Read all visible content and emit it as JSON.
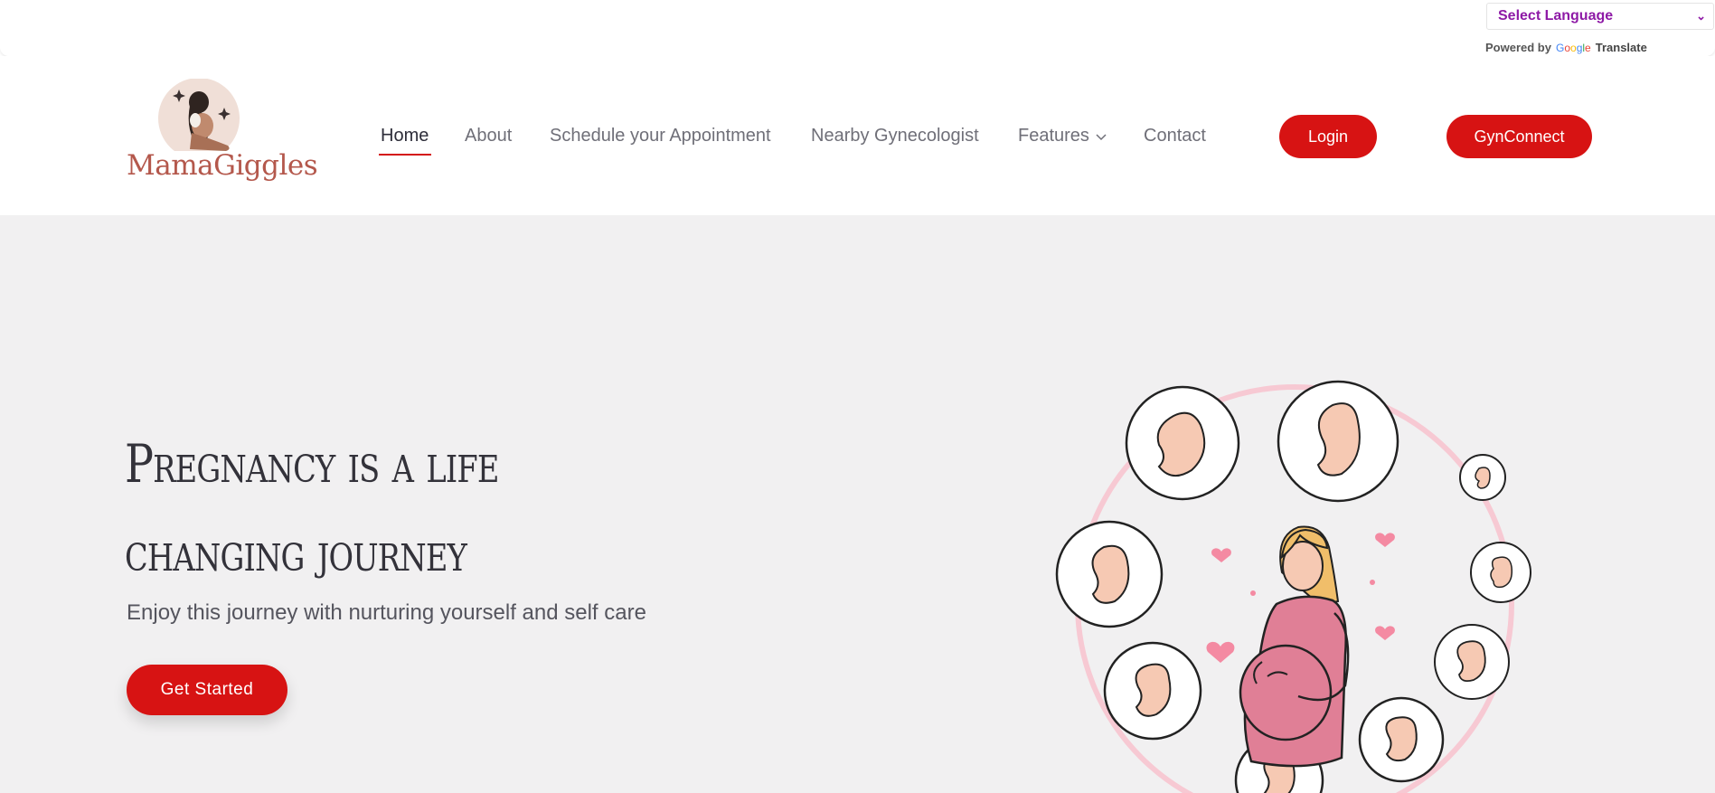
{
  "translate": {
    "select_label": "Select Language",
    "powered_by": "Powered by",
    "google": "Google",
    "translate": "Translate"
  },
  "brand": {
    "name": "MamaGiggles"
  },
  "nav": {
    "items": [
      {
        "label": "Home"
      },
      {
        "label": "About"
      },
      {
        "label": "Schedule your Appointment"
      },
      {
        "label": "Nearby Gynecologist"
      },
      {
        "label": "Features"
      },
      {
        "label": "Contact"
      }
    ],
    "active": "Home",
    "login": "Login",
    "gynconnect": "GynConnect"
  },
  "hero": {
    "title_line1": "Pregnancy is a life",
    "title_line2": "changing journey",
    "subtitle": "Enjoy this journey with nurturing yourself and self care",
    "cta": "Get Started"
  },
  "colors": {
    "accent": "#d71313",
    "hero_bg": "#f1f0f1",
    "brand_text": "#b4584c",
    "translate_text": "#8e1aa6"
  }
}
